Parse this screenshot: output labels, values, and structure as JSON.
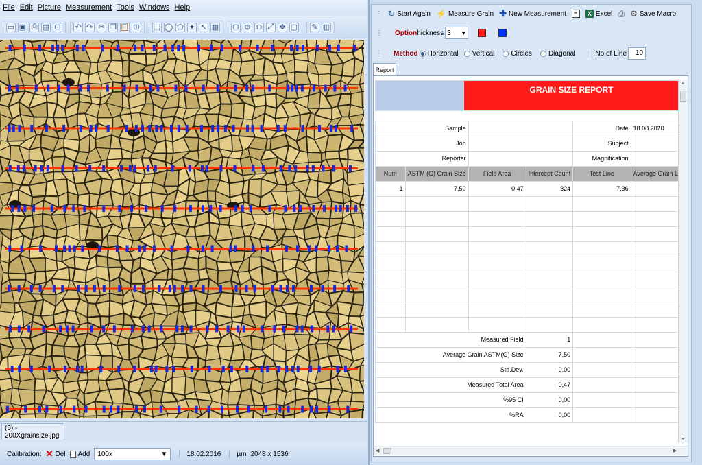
{
  "menu": [
    "File",
    "Edit",
    "Picture",
    "Measurement",
    "Tools",
    "Windows",
    "Help"
  ],
  "toolbar_icons": [
    "new-icon",
    "save-icon",
    "print-icon",
    "open-icon",
    "crop-icon",
    "undo-icon",
    "redo-icon",
    "cut-icon",
    "copy-icon",
    "paste-icon",
    "measure-icon",
    "rect-select-icon",
    "ellipse-select-icon",
    "polygon-select-icon",
    "magic-wand-icon",
    "pointer-icon",
    "grid-icon",
    "calibrate-icon",
    "zoom-in-icon",
    "zoom-out-icon",
    "fit-icon",
    "pan-icon",
    "window-icon",
    "note-icon",
    "ruler-icon"
  ],
  "file_tab": "(5) - 200Xgrainsize.jpg",
  "status": {
    "calibration_label": "Calibration:",
    "del_label": "Del",
    "add_label": "Add",
    "calibration_value": "100x",
    "date": "18.02.2016",
    "unit": "µm",
    "dimensions": "2048 x 1536"
  },
  "panel": {
    "start_again": "Start Again",
    "measure_grain": "Measure Grain",
    "new_measurement": "New Measurement",
    "excel": "Excel",
    "save_macro": "Save Macro",
    "option_label": "Option",
    "thickness_label": "hickness",
    "thickness_value": "3",
    "color1": "#ff1a1a",
    "color2": "#0033ff",
    "method_label": "Method",
    "methods": [
      "Horizontal",
      "Vertical",
      "Circles",
      "Diagonal"
    ],
    "selected_method": "Horizontal",
    "lines_label": "No of Line",
    "lines_value": "10",
    "report_tab": "Report"
  },
  "report": {
    "title": "GRAIN SIZE REPORT",
    "title_color": "#ff1a1a",
    "header_band_color": "#b9cde8",
    "meta_left": [
      {
        "label": "Sample",
        "value": ""
      },
      {
        "label": "Job",
        "value": ""
      },
      {
        "label": "Reporter",
        "value": ""
      }
    ],
    "meta_right": [
      {
        "label": "Date",
        "value": "18.08.2020"
      },
      {
        "label": "Subject",
        "value": ""
      },
      {
        "label": "Magnification",
        "value": ""
      }
    ],
    "columns": [
      "Num",
      "ASTM (G) Grain Size",
      "Field Area",
      "Intercept Count",
      "Test Line",
      "Average Grain Len"
    ],
    "rows": [
      [
        "1",
        "7,50",
        "0,47",
        "324",
        "7,36",
        ""
      ]
    ],
    "summary": [
      {
        "label": "Measured Field",
        "value": "1"
      },
      {
        "label": "Average Grain ASTM(G) Size",
        "value": "7,50"
      },
      {
        "label": "Std.Dev.",
        "value": "0,00"
      },
      {
        "label": "Measured Total Area",
        "value": "0,47"
      },
      {
        "label": "%95 CI",
        "value": "0,00"
      },
      {
        "label": "%RA",
        "value": "0,00"
      }
    ]
  },
  "image": {
    "line_count": 10,
    "line_color": "#ff3300",
    "marker_color": "#1a2bd6"
  }
}
